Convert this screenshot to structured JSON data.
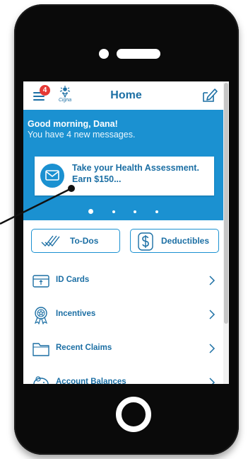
{
  "header": {
    "title": "Home",
    "badge_count": "4",
    "logo_text": "Cigna"
  },
  "banner": {
    "greeting": "Good morning, Dana!",
    "messages": "You have 4 new messages.",
    "card_text": "Take your Health Assessment. Earn $150...",
    "carousel_dots": 4,
    "active_dot": 0
  },
  "quick_actions": [
    {
      "label": "To-Dos",
      "icon": "checkmarks-icon"
    },
    {
      "label": "Deductibles",
      "icon": "dollar-icon"
    }
  ],
  "list": [
    {
      "label": "ID Cards",
      "icon": "id-card-icon"
    },
    {
      "label": "Incentives",
      "icon": "award-ribbon-icon"
    },
    {
      "label": "Recent Claims",
      "icon": "folder-icon"
    },
    {
      "label": "Account Balances",
      "icon": "piggy-bank-icon"
    }
  ],
  "colors": {
    "brand_blue": "#1b91d1",
    "text_blue": "#1c6fa4",
    "badge_red": "#e53935",
    "phone_black": "#0a0a0a"
  }
}
